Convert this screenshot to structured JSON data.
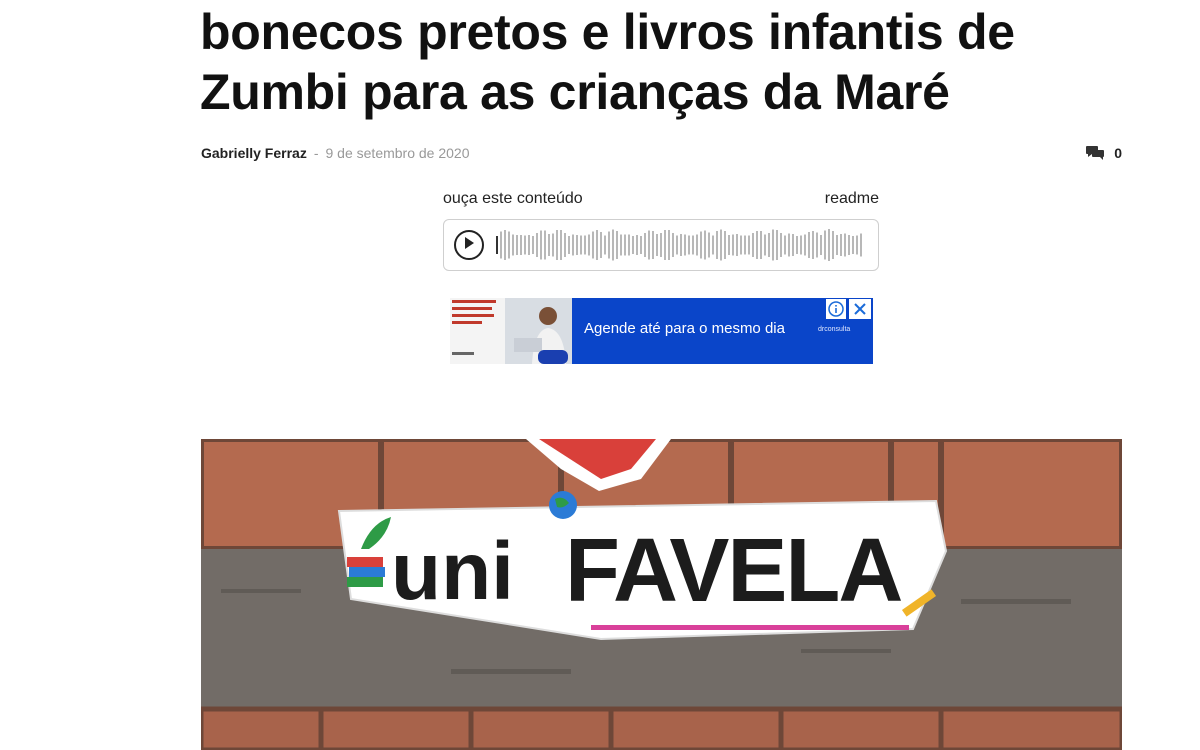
{
  "article": {
    "headline_line1": "bonecos pretos e livros infantis de",
    "headline_line2": "Zumbi para as crianças da Maré",
    "author": "Gabrielly Ferraz",
    "separator": "-",
    "date": "9 de setembro de 2020",
    "comment_count": "0",
    "comment_icon": "comments-icon"
  },
  "player": {
    "listen_label": "ouça este conteúdo",
    "brand_label": "readme",
    "play_icon": "play-icon"
  },
  "ad": {
    "text": "Agende até para o mesmo dia",
    "brand": "drconsulta",
    "info_icon": "info-icon",
    "close_icon": "close-icon",
    "background_color": "#0a45c9"
  },
  "photo": {
    "sign_text": "unifavela"
  }
}
